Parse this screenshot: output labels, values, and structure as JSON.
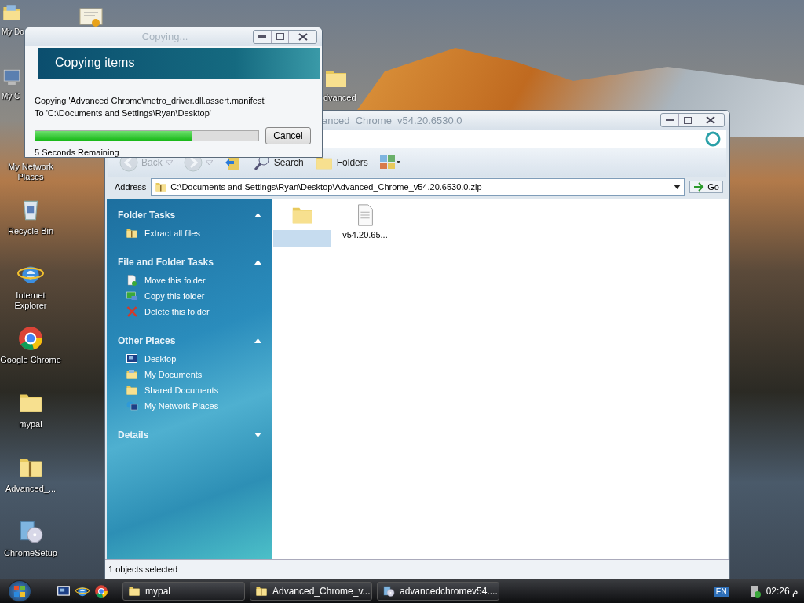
{
  "desktop": {
    "icons": [
      {
        "label": "My Do",
        "kind": "folder-docs",
        "cut": true
      },
      {
        "label": "My C",
        "kind": "computer",
        "cut": true
      },
      {
        "label": "My Network Places",
        "cut": false
      },
      {
        "label": "Recycle Bin",
        "kind": "recycle",
        "cut": false
      },
      {
        "label": "Internet Explorer",
        "kind": "ie",
        "cut": false
      },
      {
        "label": "Google Chrome",
        "kind": "chrome",
        "cut": false
      },
      {
        "label": "mypal",
        "kind": "folder",
        "cut": false
      },
      {
        "label": "Advanced_...",
        "kind": "zip",
        "cut": false
      },
      {
        "label": "ChromeSetup",
        "kind": "setup",
        "cut": false
      }
    ],
    "extra_icons": [
      {
        "kind": "certificate"
      },
      {
        "label": "dvanced",
        "kind": "folder"
      }
    ]
  },
  "explorer": {
    "title": "anced_Chrome_v54.20.6530.0",
    "toolbar": [
      {
        "label": "Back",
        "kind": "back",
        "disabled": true
      },
      {
        "kind": "forward",
        "disabled": true
      },
      {
        "kind": "up",
        "disabled": false
      },
      {
        "label": "Search",
        "kind": "search",
        "disabled": false
      },
      {
        "label": "Folders",
        "kind": "folders",
        "disabled": false
      },
      {
        "kind": "views",
        "disabled": false
      }
    ],
    "address": {
      "label": "Address",
      "value": "C:\\Documents and Settings\\Ryan\\Desktop\\Advanced_Chrome_v54.20.6530.0.zip",
      "go": "Go"
    },
    "sidebar": [
      {
        "title": "Folder Tasks",
        "expanded": true,
        "items": [
          {
            "label": "Extract all files",
            "kind": "zip"
          }
        ]
      },
      {
        "title": "File and Folder Tasks",
        "expanded": true,
        "items": [
          {
            "label": "Move this folder",
            "kind": "move"
          },
          {
            "label": "Copy this folder",
            "kind": "copy"
          },
          {
            "label": "Delete this folder",
            "kind": "delete"
          }
        ]
      },
      {
        "title": "Other Places",
        "expanded": true,
        "items": [
          {
            "label": "Desktop",
            "kind": "desktop"
          },
          {
            "label": "My Documents",
            "kind": "folder-docs"
          },
          {
            "label": "Shared Documents",
            "kind": "folder"
          },
          {
            "label": "My Network Places",
            "kind": "network"
          }
        ]
      },
      {
        "title": "Details",
        "expanded": false
      }
    ],
    "files": [
      {
        "kind": "folder",
        "selected": true
      },
      {
        "label": "v54.20.65...",
        "kind": "document",
        "selected": false
      }
    ],
    "status_bar": "1 objects selected"
  },
  "copy_dialog": {
    "title": "Copying...",
    "heading": "Copying items",
    "line_1": "Copying 'Advanced Chrome\\metro_driver.dll.assert.manifest'",
    "line_2": "To 'C:\\Documents and Settings\\Ryan\\Desktop'",
    "level": 0.7,
    "button": "Cancel",
    "remaining": "5 Seconds Remaining"
  },
  "taskbar": {
    "quick_launch": [
      {
        "kind": "desktop"
      },
      {
        "kind": "ie"
      },
      {
        "kind": "chrome"
      }
    ],
    "tasks": [
      {
        "label": "mypal",
        "kind": "folder"
      },
      {
        "label": "Advanced_Chrome_v...",
        "kind": "zip"
      },
      {
        "label": "advancedchromev54....",
        "kind": "setup"
      }
    ],
    "language": "EN",
    "clock": "02:26 م"
  }
}
